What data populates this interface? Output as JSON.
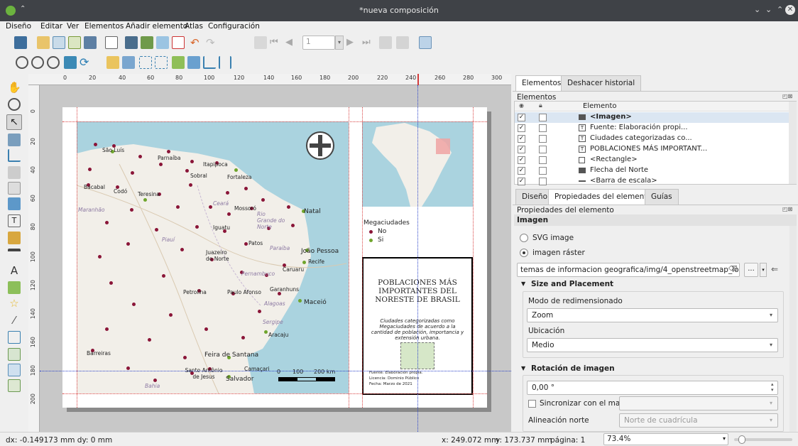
{
  "window": {
    "title": "*nueva composición"
  },
  "menu": [
    "Diseño",
    "Editar",
    "Ver",
    "Elementos",
    "Añadir elemento",
    "Atlas",
    "Configuración"
  ],
  "toolbar": {
    "page_field": "1"
  },
  "ruler": {
    "ticks": [
      "0",
      "20",
      "40",
      "60",
      "80",
      "100",
      "120",
      "140",
      "160",
      "180",
      "200",
      "220",
      "240",
      "260",
      "280",
      "300"
    ],
    "vticks": [
      "0",
      "20",
      "40",
      "60",
      "80",
      "100",
      "120",
      "140",
      "160",
      "180",
      "200"
    ]
  },
  "layout": {
    "legend_title": "Megaciudades",
    "legend_items": [
      "No",
      "Si"
    ],
    "title_text": "POBLACIONES MÁS IMPORTANTES DEL NORESTE DE BRASIL",
    "subtitle_text": "Ciudades categorizadas como Megaciudades de acuerdo a la cantidad de población, importancia y extensión urbana.",
    "source_lines": [
      "Fuente: Elaboración propia.",
      "Licencia: Dominio Público",
      "Fecha: Marzo de 2021"
    ],
    "scale_labels": [
      "0",
      "100",
      "200 km"
    ],
    "cities": [
      "São Luís",
      "Parnaíba",
      "Itapipoca",
      "Sobral",
      "Fortaleza",
      "Bacabal",
      "Codó",
      "Teresina",
      "Ceará",
      "Mossoró",
      "Rio Grande do Norte",
      "Natal",
      "Maranhão",
      "Iguatu",
      "Piauí",
      "Patos",
      "Paraíba",
      "João Pessoa",
      "Juazeiro do Norte",
      "Pernambuco",
      "Caruaru",
      "Recife",
      "Petrolina",
      "Paulo Afonso",
      "Garanhuns",
      "Alagoas",
      "Maceió",
      "Sergipe",
      "Aracaju",
      "Barreiras",
      "Feira de Santana",
      "Santo Antônio de Jesus",
      "Camaçari",
      "Salvador",
      "Bahia"
    ],
    "colors": {
      "sea": "#aad3df",
      "land": "#f2efe9",
      "city": "#8a1538",
      "mega": "#6fa52c"
    }
  },
  "dock": {
    "tabs": [
      "Elementos",
      "Deshacer historial"
    ],
    "items_header": "Elementos",
    "col_elemento": "Elemento",
    "items": [
      "<Imagen>",
      "Fuente: Elaboración propi...",
      "Ciudades categorizadas co...",
      "POBLACIONES MÁS IMPORTANT...",
      "<Rectangle>",
      "Flecha del Norte",
      "<Barra de escala>"
    ],
    "prop_tabs": [
      "Diseño",
      "Propiedades del elemento",
      "Guías"
    ],
    "prop_header": "Propiedades del elemento",
    "section": "Imagen",
    "svg_label": "SVG image",
    "raster_label": "imagen ráster",
    "path": "temas de informacion geografica/img/4_openstreetmap_logo.png",
    "size_section": "Size and Placement",
    "resize_label": "Modo de redimensionado",
    "resize_value": "Zoom",
    "placement_label": "Ubicación",
    "placement_value": "Medio",
    "rotation_section": "Rotación de imagen",
    "rotation_value": "0,00 °",
    "sync_label": "Sincronizar con el mapa",
    "north_label": "Alineación norte",
    "north_value": "Norte de cuadrícula",
    "more_btn": "..."
  },
  "status": {
    "delta": "dx: -0.149173 mm dy: 0 mm",
    "x": "x: 249.072 mm",
    "y": "y: 173.737 mm",
    "page": "página: 1",
    "zoom": "73.4%"
  }
}
